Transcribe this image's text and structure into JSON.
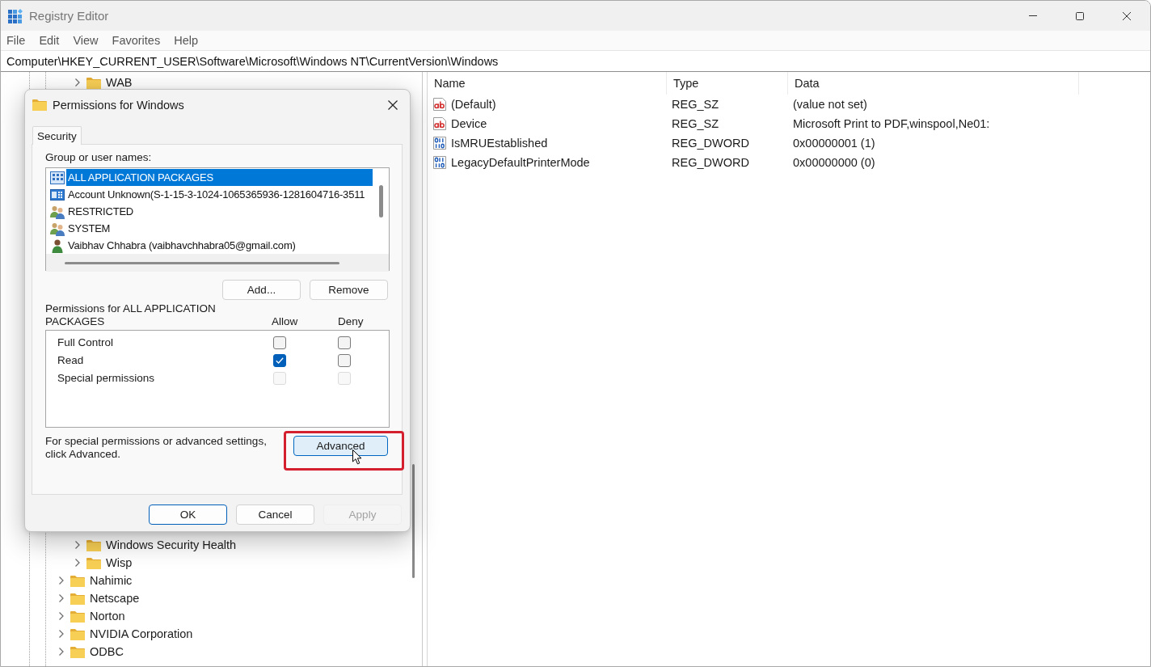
{
  "window": {
    "title": "Registry Editor"
  },
  "menu": [
    {
      "label": "File"
    },
    {
      "label": "Edit"
    },
    {
      "label": "View"
    },
    {
      "label": "Favorites"
    },
    {
      "label": "Help"
    }
  ],
  "address_bar": {
    "value": "Computer\\HKEY_CURRENT_USER\\Software\\Microsoft\\Windows NT\\CurrentVersion\\Windows"
  },
  "tree": [
    {
      "children": [
        {
          "label": "WAB",
          "expanded": false,
          "selected": false
        },
        {
          "label": "Windows Security Health",
          "expanded": false,
          "selected": false
        },
        {
          "label": "Wisp",
          "expanded": false,
          "selected": false
        }
      ]
    },
    {
      "label": "Nahimic",
      "expanded": false,
      "selected": false
    },
    {
      "label": "Netscape",
      "expanded": false,
      "selected": false
    },
    {
      "label": "Norton",
      "expanded": false,
      "selected": false
    },
    {
      "label": "NVIDIA Corporation",
      "expanded": false,
      "selected": false
    },
    {
      "label": "ODBC",
      "expanded": false,
      "selected": false
    }
  ],
  "values": {
    "columns": [
      {
        "label": "Name"
      },
      {
        "label": "Type"
      },
      {
        "label": "Data"
      }
    ],
    "rows": [
      {
        "kind": "string",
        "name": "(Default)",
        "type": "REG_SZ",
        "data": "(value not set)",
        "selected": false
      },
      {
        "kind": "string",
        "name": "Device",
        "type": "REG_SZ",
        "data": "Microsoft Print to PDF,winspool,Ne01:",
        "selected": false
      },
      {
        "kind": "binary",
        "name": "IsMRUEstablished",
        "type": "REG_DWORD",
        "data": "0x00000001 (1)",
        "selected": false
      },
      {
        "kind": "binary",
        "name": "LegacyDefaultPrinterMode",
        "type": "REG_DWORD",
        "data": "0x00000000 (0)",
        "selected": false
      }
    ]
  },
  "dialog": {
    "title": "Permissions for Windows",
    "tabs": [
      {
        "label": "Security",
        "selected": true
      }
    ],
    "principals_label": "Group or user names:",
    "principals": [
      {
        "kind": "packages",
        "name": "ALL APPLICATION PACKAGES",
        "selected": true
      },
      {
        "kind": "account",
        "name": "Account Unknown(S-1-15-3-1024-1065365936-1281604716-3511",
        "selected": false
      },
      {
        "kind": "group",
        "name": "RESTRICTED",
        "selected": false
      },
      {
        "kind": "group",
        "name": "SYSTEM",
        "selected": false
      },
      {
        "kind": "user",
        "name": "Vaibhav Chhabra (vaibhavchhabra05@gmail.com)",
        "selected": false
      }
    ],
    "principal_buttons": [
      {
        "label": "Add..."
      },
      {
        "label": "Remove"
      }
    ],
    "permissions_label": "Permissions for ALL APPLICATION PACKAGES",
    "permission_columns": [
      {
        "label": "Allow"
      },
      {
        "label": "Deny"
      }
    ],
    "permissions": [
      {
        "name": "Full Control",
        "cells": [
          {
            "checked": false,
            "disabled": false
          },
          {
            "checked": false,
            "disabled": false
          }
        ]
      },
      {
        "name": "Read",
        "cells": [
          {
            "checked": true,
            "disabled": false
          },
          {
            "checked": false,
            "disabled": false
          }
        ]
      },
      {
        "name": "Special permissions",
        "cells": [
          {
            "checked": false,
            "disabled": true
          },
          {
            "checked": false,
            "disabled": true
          }
        ]
      }
    ],
    "advanced_hint": "For special permissions or advanced settings, click Advanced.",
    "advanced_button": {
      "label": "Advanced",
      "hovered": true,
      "highlighted": true
    },
    "buttons": [
      {
        "label": "OK",
        "default": true,
        "disabled": false
      },
      {
        "label": "Cancel",
        "default": false,
        "disabled": false
      },
      {
        "label": "Apply",
        "default": false,
        "disabled": true
      }
    ]
  }
}
